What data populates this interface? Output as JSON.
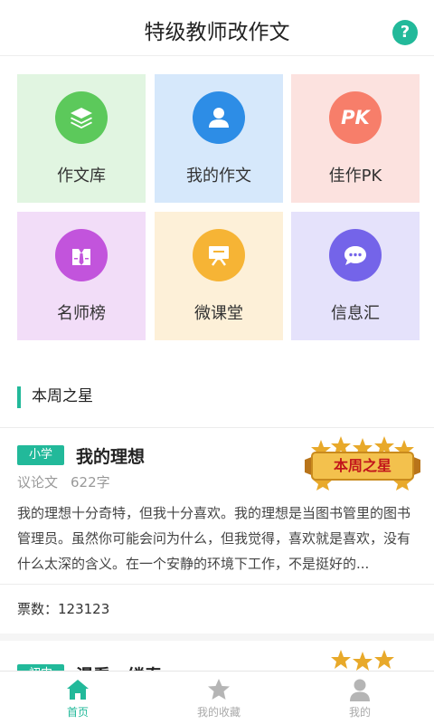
{
  "header": {
    "title": "特级教师改作文",
    "help_icon": "question-mark-icon",
    "help_glyph": "?"
  },
  "tiles": [
    {
      "label": "作文库",
      "icon": "layers-icon",
      "bg": "#e1f5e1",
      "circle": "#5cc95b"
    },
    {
      "label": "我的作文",
      "icon": "user-icon",
      "bg": "#d6e8fb",
      "circle": "#2d8de6"
    },
    {
      "label": "佳作PK",
      "icon": "pk-icon",
      "bg": "#fce2df",
      "circle": "#f77e6a",
      "glyph": "PK"
    },
    {
      "label": "名师榜",
      "icon": "teacher-icon",
      "bg": "#f2ddf8",
      "circle": "#c254dc"
    },
    {
      "label": "微课堂",
      "icon": "board-icon",
      "bg": "#fdf0d8",
      "circle": "#f6b435"
    },
    {
      "label": "信息汇",
      "icon": "chat-bubble-icon",
      "bg": "#e5e2fb",
      "circle": "#7464e9"
    }
  ],
  "section": {
    "title": "本周之星"
  },
  "essays": [
    {
      "tag": "小学",
      "title": "我的理想",
      "genre": "议论文",
      "word_count": "622字",
      "badge": "本周之星",
      "excerpt": "我的理想十分奇特，但我十分喜欢。我的理想是当图书管里的图书管理员。虽然你可能会问为什么，但我觉得，喜欢就是喜欢，没有什么太深的含义。在一个安静的环境下工作，不是挺好的...",
      "votes": "票数：123123"
    },
    {
      "tag": "初中",
      "title": "漫看一缕春",
      "badge": "本周之星"
    }
  ],
  "tabbar": [
    {
      "label": "首页",
      "icon": "home-icon",
      "active": true
    },
    {
      "label": "我的收藏",
      "icon": "star-icon",
      "active": false
    },
    {
      "label": "我的",
      "icon": "person-icon",
      "active": false
    }
  ],
  "colors": {
    "accent": "#22b99a"
  }
}
